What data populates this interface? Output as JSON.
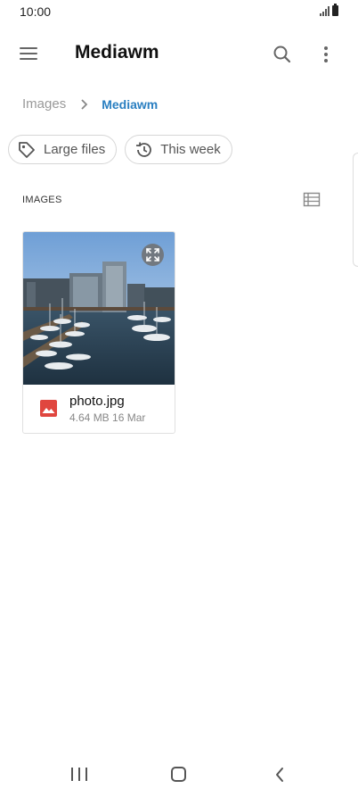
{
  "status_bar": {
    "time": "10:00",
    "signal_icon": "signal-icon",
    "battery_icon": "battery-icon"
  },
  "app_bar": {
    "title": "Mediawm",
    "menu_icon": "hamburger-menu-icon",
    "search_icon": "search-icon",
    "more_icon": "more-vert-icon"
  },
  "breadcrumb": {
    "root": "Images",
    "separator_icon": "chevron-right-icon",
    "current": "Mediawm"
  },
  "filters": [
    {
      "label": "Large files",
      "icon": "tag-icon"
    },
    {
      "label": "This week",
      "icon": "history-icon"
    }
  ],
  "section": {
    "label": "IMAGES",
    "view_toggle_icon": "list-view-icon"
  },
  "files": [
    {
      "name": "photo.jpg",
      "size": "4.64 MB",
      "date": "16 Mar",
      "meta": "4.64 MB 16 Mar",
      "type_icon": "image-file-icon",
      "expand_icon": "expand-icon"
    }
  ],
  "nav_bar": {
    "recents_icon": "recents-icon",
    "home_icon": "home-icon",
    "back_icon": "back-icon"
  },
  "colors": {
    "accent": "#2a7fc1",
    "image_icon": "#e0463f",
    "muted_text": "#999999"
  }
}
